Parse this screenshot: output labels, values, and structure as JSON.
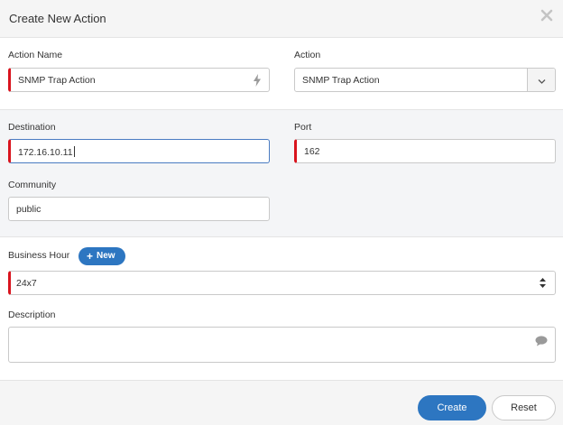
{
  "dialog": {
    "title": "Create New Action",
    "close_icon": "close-icon"
  },
  "form": {
    "action_name": {
      "label": "Action Name",
      "value": "SNMP Trap Action",
      "icon": "lightning-icon"
    },
    "action": {
      "label": "Action",
      "selected": "SNMP Trap Action",
      "icon": "chevron-down-icon"
    },
    "destination": {
      "label": "Destination",
      "value": "172.16.10.11"
    },
    "port": {
      "label": "Port",
      "value": "162"
    },
    "community": {
      "label": "Community",
      "value": "public"
    },
    "business_hour": {
      "label": "Business Hour",
      "new_label": "New",
      "selected": "24x7",
      "icon": "sort-arrows-icon"
    },
    "description": {
      "label": "Description",
      "value": "",
      "icon": "comment-icon"
    }
  },
  "footer": {
    "create_label": "Create",
    "reset_label": "Reset"
  },
  "colors": {
    "primary": "#2d76c1",
    "required": "#d9141e",
    "focus_border": "#4a7bc2"
  }
}
